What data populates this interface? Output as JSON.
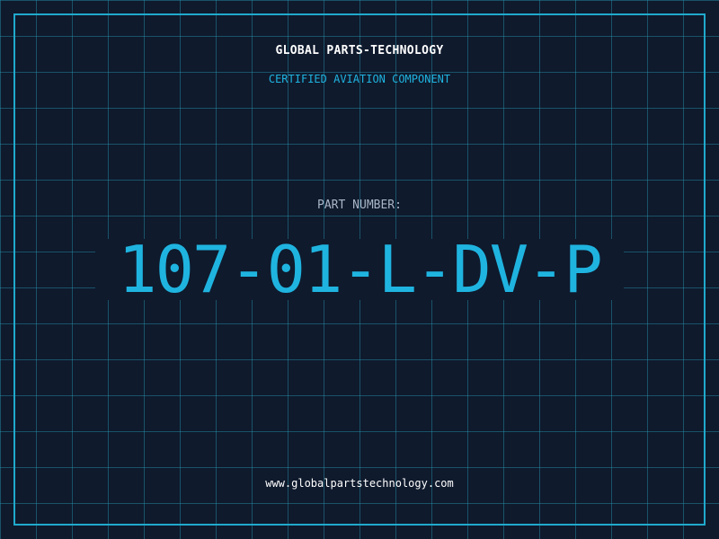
{
  "header": {
    "company_name": "GLOBAL PARTS-TECHNOLOGY",
    "tagline": "CERTIFIED AVIATION COMPONENT"
  },
  "part": {
    "label": "PART NUMBER:",
    "number": "107-01-L-DV-P"
  },
  "footer": {
    "website": "www.globalpartstechnology.com"
  },
  "colors": {
    "background": "#0f1a2d",
    "grid": "#2896af",
    "accent": "#1fb4e0",
    "text": "#ffffff",
    "label": "#a9b6c8"
  }
}
